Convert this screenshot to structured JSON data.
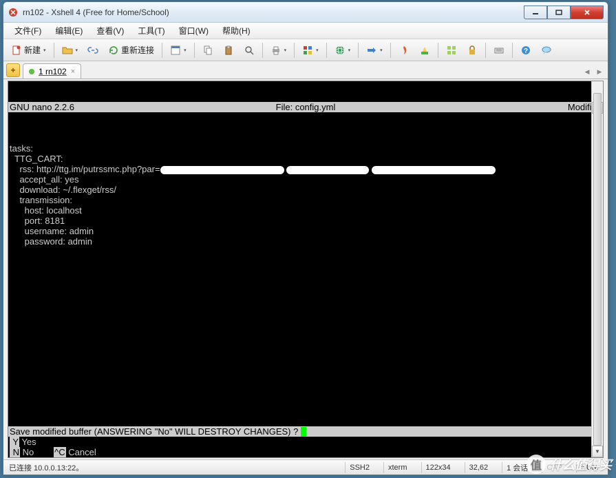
{
  "window": {
    "title": "rn102 - Xshell 4 (Free for Home/School)"
  },
  "menu": {
    "file": "文件(F)",
    "edit": "编辑(E)",
    "view": "查看(V)",
    "tools": "工具(T)",
    "window": "窗口(W)",
    "help": "帮助(H)"
  },
  "toolbar": {
    "new_label": "新建",
    "reconnect_label": "重新连接"
  },
  "tabs": {
    "tab1_label": "1 rn102"
  },
  "terminal": {
    "editor_name": "GNU nano 2.2.6",
    "file_label": "File: config.yml",
    "modified_label": "Modified",
    "content": "\ntasks:\n  TTG_CART:\n    rss: http://ttg.im/putrssmc.php?par=",
    "content2": "    accept_all: yes\n    download: ~/.flexget/rss/\n    transmission:\n      host: localhost\n      port: 8181\n      username: admin\n      password: admin",
    "prompt": "Save modified buffer (ANSWERING \"No\" WILL DESTROY CHANGES) ? ",
    "key_y": " Y",
    "opt_yes": " Yes",
    "key_n": " N",
    "opt_no": " No",
    "key_c": "^C",
    "opt_cancel": " Cancel"
  },
  "status": {
    "connection": "已连接 10.0.0.13:22。",
    "protocol": "SSH2",
    "term_type": "xterm",
    "size": "122x34",
    "cursor": "32,62",
    "session": "1 会话",
    "caps": "CAP",
    "num": "NUM"
  },
  "watermark": {
    "text": "什么值得买"
  }
}
